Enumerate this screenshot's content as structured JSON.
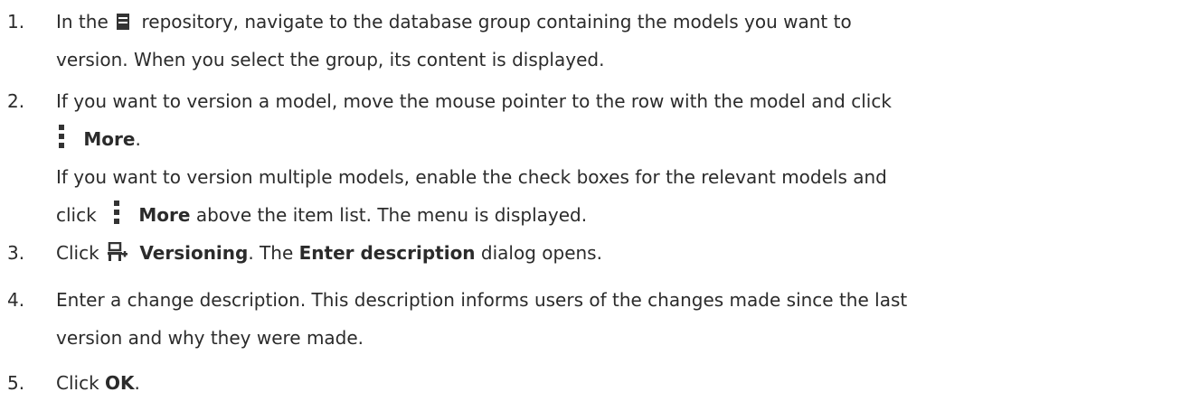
{
  "steps": [
    {
      "number": "1.",
      "p1": "In the",
      "p2": "repository, navigate to the database group containing the models you want to",
      "p3": "version. When you select the group, its content is displayed."
    },
    {
      "number": "2.",
      "p1": "If you want to version a model, move the mouse pointer to the row with the model and click",
      "more": "More",
      "p2": ".",
      "p3": "If you want to version multiple models, enable the check boxes for the relevant models and",
      "p4": "click",
      "more2": "More",
      "p5": "above the item list. The menu is displayed."
    },
    {
      "number": "3.",
      "p1": "Click",
      "versioning": "Versioning",
      "p2": ". The",
      "enter_description": "Enter description",
      "p3": "dialog opens."
    },
    {
      "number": "4.",
      "p1": "Enter a change description. This description informs users of the changes made since the last",
      "p2": "version and why they were made."
    },
    {
      "number": "5.",
      "p1": "Click",
      "ok": "OK",
      "p2": "."
    }
  ],
  "icons": [
    "repository-icon",
    "more-icon",
    "versioning-icon"
  ]
}
